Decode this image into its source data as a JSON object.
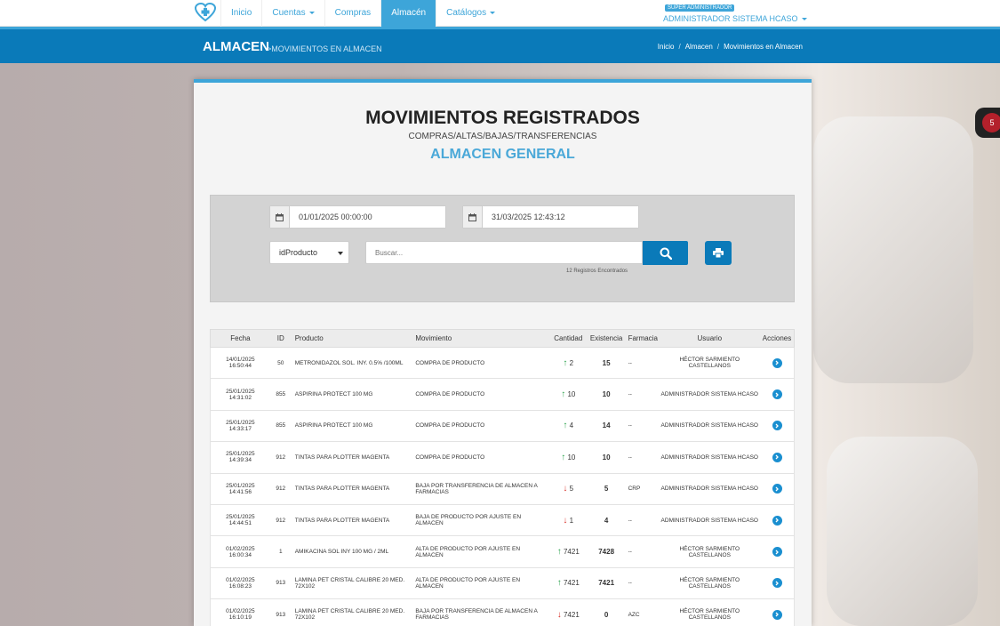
{
  "nav": {
    "items": [
      {
        "label": "Inicio",
        "dropdown": false,
        "active": false
      },
      {
        "label": "Cuentas",
        "dropdown": true,
        "active": false
      },
      {
        "label": "Compras",
        "dropdown": false,
        "active": false
      },
      {
        "label": "Almacén",
        "dropdown": false,
        "active": true
      },
      {
        "label": "Catálogos",
        "dropdown": true,
        "active": false
      }
    ],
    "role_badge": "SUPER ADMINISTRADOR",
    "user_name": "ADMINISTRADOR SISTEMA HCASO"
  },
  "header": {
    "title": "ALMACEN",
    "subtitle": ">MOVIMIENTOS EN ALMACEN",
    "breadcrumb": [
      "Inicio",
      "Almacen",
      "Movimientos en Almacen"
    ]
  },
  "page": {
    "title": "MOVIMIENTOS REGISTRADOS",
    "subtitle": "COMPRAS/ALTAS/BAJAS/TRANSFERENCIAS",
    "store": "ALMACEN GENERAL"
  },
  "filters": {
    "date_from": "01/01/2025 00:00:00",
    "date_to": "31/03/2025 12:43:12",
    "select_value": "idProducto",
    "search_placeholder": "Buscar...",
    "records_text": "12 Registros Encontrados"
  },
  "table": {
    "headers": [
      "Fecha",
      "ID",
      "Producto",
      "Movimiento",
      "Cantidad",
      "Existencia",
      "Farmacia",
      "Usuario",
      "Acciones"
    ],
    "rows": [
      {
        "date": "14/01/2025",
        "time": "16:50:44",
        "id": "50",
        "product": "METRONIDAZOL SOL. INY. 0.5% /100ML",
        "movement": "COMPRA DE PRODUCTO",
        "dir": "up",
        "qty": "2",
        "stock": "15",
        "pharmacy": "--",
        "user": "HÉCTOR SARMIENTO CASTELLANOS"
      },
      {
        "date": "25/01/2025",
        "time": "14:31:02",
        "id": "855",
        "product": "ASPIRINA PROTECT 100 MG",
        "movement": "COMPRA DE PRODUCTO",
        "dir": "up",
        "qty": "10",
        "stock": "10",
        "pharmacy": "--",
        "user": "ADMINISTRADOR SISTEMA HCASO"
      },
      {
        "date": "25/01/2025",
        "time": "14:33:17",
        "id": "855",
        "product": "ASPIRINA PROTECT 100 MG",
        "movement": "COMPRA DE PRODUCTO",
        "dir": "up",
        "qty": "4",
        "stock": "14",
        "pharmacy": "--",
        "user": "ADMINISTRADOR SISTEMA HCASO"
      },
      {
        "date": "25/01/2025",
        "time": "14:39:34",
        "id": "912",
        "product": "TINTAS PARA PLOTTER MAGENTA",
        "movement": "COMPRA DE PRODUCTO",
        "dir": "up",
        "qty": "10",
        "stock": "10",
        "pharmacy": "--",
        "user": "ADMINISTRADOR SISTEMA HCASO"
      },
      {
        "date": "25/01/2025",
        "time": "14:41:56",
        "id": "912",
        "product": "TINTAS PARA PLOTTER MAGENTA",
        "movement": "BAJA POR TRANSFERENCIA DE ALMACEN A FARMACIAS",
        "dir": "down",
        "qty": "5",
        "stock": "5",
        "pharmacy": "CRP",
        "user": "ADMINISTRADOR SISTEMA HCASO"
      },
      {
        "date": "25/01/2025",
        "time": "14:44:51",
        "id": "912",
        "product": "TINTAS PARA PLOTTER MAGENTA",
        "movement": "BAJA DE PRODUCTO POR AJUSTE EN ALMACEN",
        "dir": "down",
        "qty": "1",
        "stock": "4",
        "pharmacy": "--",
        "user": "ADMINISTRADOR SISTEMA HCASO"
      },
      {
        "date": "01/02/2025",
        "time": "16:00:34",
        "id": "1",
        "product": "AMIKACINA SOL INY 100 MG / 2ML",
        "movement": "ALTA DE PRODUCTO POR AJUSTE EN ALMACEN",
        "dir": "up",
        "qty": "7421",
        "stock": "7428",
        "pharmacy": "--",
        "user": "HÉCTOR SARMIENTO CASTELLANOS"
      },
      {
        "date": "01/02/2025",
        "time": "16:08:23",
        "id": "913",
        "product": "LAMINA PET CRISTAL CALIBRE 20 MED. 72X102",
        "movement": "ALTA DE PRODUCTO POR AJUSTE EN ALMACEN",
        "dir": "up",
        "qty": "7421",
        "stock": "7421",
        "pharmacy": "--",
        "user": "HÉCTOR SARMIENTO CASTELLANOS"
      },
      {
        "date": "01/02/2025",
        "time": "16:10:19",
        "id": "913",
        "product": "LAMINA PET CRISTAL CALIBRE 20 MED. 72X102",
        "movement": "BAJA POR TRANSFERENCIA DE ALMACEN A FARMACIAS",
        "dir": "down",
        "qty": "7421",
        "stock": "0",
        "pharmacy": "AZC",
        "user": "HÉCTOR SARMIENTO CASTELLANOS"
      }
    ]
  },
  "side_badge": {
    "count": "5"
  },
  "icons": {
    "calendar": "calendar-icon",
    "search": "search-icon",
    "print": "print-icon",
    "action": "chevron-right-circle-icon"
  },
  "colors": {
    "accent": "#3da5d9",
    "header": "#0a7ab9",
    "up": "#2ea44f",
    "down": "#d9342b"
  }
}
